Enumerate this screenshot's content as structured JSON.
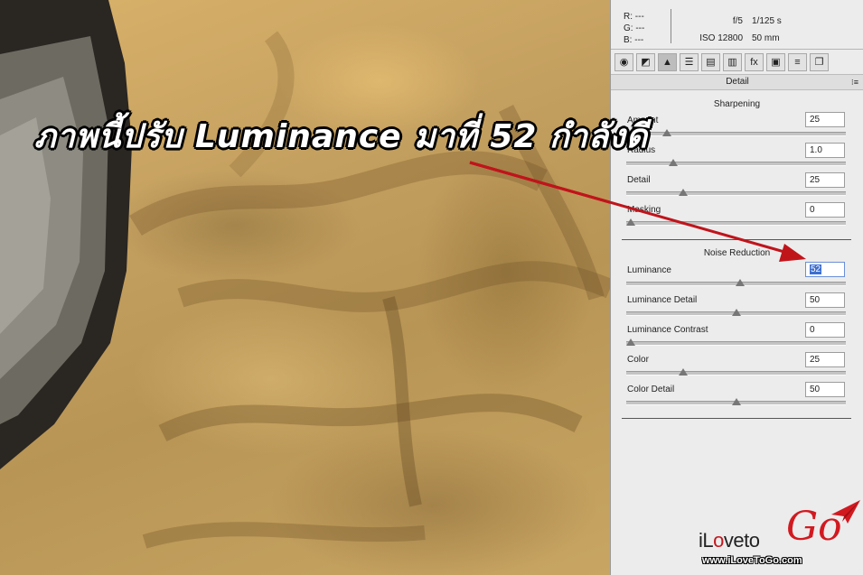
{
  "overlay_text": "ภาพนี้ปรับ Luminance มาที่ 52 กำลังดี",
  "info": {
    "r_label": "R:",
    "r_value": "---",
    "g_label": "G:",
    "g_value": "---",
    "b_label": "B:",
    "b_value": "---",
    "aperture": "f/5",
    "shutter": "1/125 s",
    "iso": "ISO 12800",
    "focal": "50 mm"
  },
  "tabs": [
    {
      "icon": "aperture-icon",
      "glyph": "◉"
    },
    {
      "icon": "tone-curve-icon",
      "glyph": "◩"
    },
    {
      "icon": "detail-icon",
      "glyph": "▲",
      "active": true
    },
    {
      "icon": "hsl-icon",
      "glyph": "☰"
    },
    {
      "icon": "split-toning-icon",
      "glyph": "▤"
    },
    {
      "icon": "lens-corrections-icon",
      "glyph": "▥"
    },
    {
      "icon": "fx-icon",
      "glyph": "fx"
    },
    {
      "icon": "camera-calibration-icon",
      "glyph": "▣"
    },
    {
      "icon": "presets-icon",
      "glyph": "≡"
    },
    {
      "icon": "snapshots-icon",
      "glyph": "❐"
    }
  ],
  "panel_title": "Detail",
  "panel_menu_glyph": "⁝≡",
  "sharpening": {
    "title": "Sharpening",
    "amount": {
      "label": "Amount",
      "value": "25",
      "level": 0.17
    },
    "radius": {
      "label": "Radius",
      "value": "1.0",
      "level": 0.2
    },
    "detail": {
      "label": "Detail",
      "value": "25",
      "level": 0.25
    },
    "masking": {
      "label": "Masking",
      "value": "0",
      "level": 0.0
    }
  },
  "noise_reduction": {
    "title": "Noise Reduction",
    "luminance": {
      "label": "Luminance",
      "value": "52",
      "level": 0.52
    },
    "luminance_detail": {
      "label": "Luminance Detail",
      "value": "50",
      "level": 0.5
    },
    "luminance_contrast": {
      "label": "Luminance Contrast",
      "value": "0",
      "level": 0.0
    },
    "color": {
      "label": "Color",
      "value": "25",
      "level": 0.25
    },
    "color_detail": {
      "label": "Color Detail",
      "value": "50",
      "level": 0.5
    }
  },
  "logo": {
    "brand_prefix": "iL",
    "brand_o": "o",
    "brand_rest": "veto",
    "brand_go": "Go",
    "url": "www.iLoveToGo.com"
  },
  "colors": {
    "arrow": "#c0141b",
    "selection": "#3d6fd1",
    "logo_red": "#d11a20"
  }
}
